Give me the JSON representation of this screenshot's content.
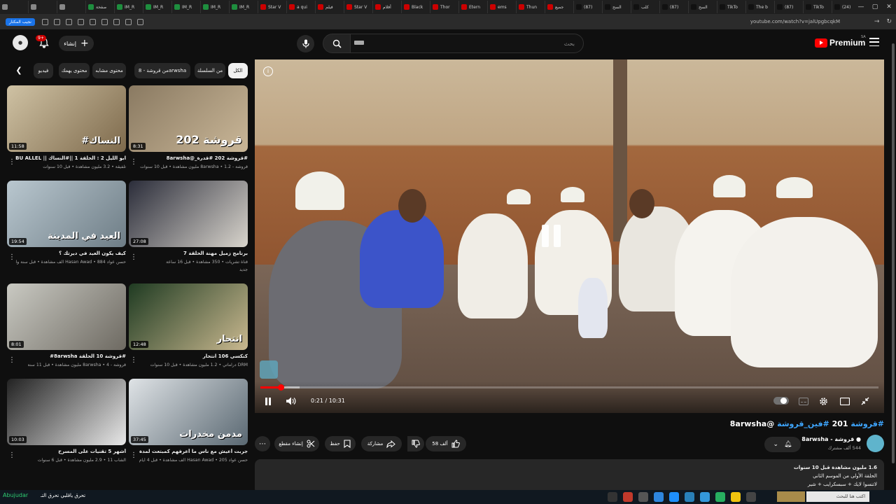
{
  "browser": {
    "tabs": [
      {
        "label": "",
        "color": "#888888"
      },
      {
        "label": "",
        "color": "#888888"
      },
      {
        "label": "",
        "color": "#888888"
      },
      {
        "label": "صفحة",
        "color": "#1e8e3e"
      },
      {
        "label": "IM_R",
        "color": "#1e8e3e"
      },
      {
        "label": "IM_R",
        "color": "#1e8e3e"
      },
      {
        "label": "IM_R",
        "color": "#1e8e3e"
      },
      {
        "label": "IM_R",
        "color": "#1e8e3e"
      },
      {
        "label": "IM_R",
        "color": "#1e8e3e"
      },
      {
        "label": "Star V",
        "color": "#cc0000"
      },
      {
        "label": "a qui",
        "color": "#cc0000"
      },
      {
        "label": "فيلم",
        "color": "#cc0000"
      },
      {
        "label": "Star V",
        "color": "#cc0000"
      },
      {
        "label": "أفلام",
        "color": "#cc0000"
      },
      {
        "label": "Black",
        "color": "#cc0000"
      },
      {
        "label": "Thor",
        "color": "#cc0000"
      },
      {
        "label": "Etern",
        "color": "#cc0000"
      },
      {
        "label": "ems",
        "color": "#cc0000"
      },
      {
        "label": "Thun",
        "color": "#cc0000"
      },
      {
        "label": "جميع",
        "color": "#cc0000"
      },
      {
        "label": "(87)",
        "color": "#111111"
      },
      {
        "label": "السح",
        "color": "#111111"
      },
      {
        "label": "كلب",
        "color": "#111111"
      },
      {
        "label": "(87)",
        "color": "#111111"
      },
      {
        "label": "السح",
        "color": "#111111"
      },
      {
        "label": "TikTo",
        "color": "#111111"
      },
      {
        "label": "The b",
        "color": "#111111"
      },
      {
        "label": "(87)",
        "color": "#111111"
      },
      {
        "label": "TikTo",
        "color": "#111111"
      },
      {
        "label": "(24)",
        "color": "#111111"
      },
      {
        "label": "(337)",
        "color": "#cc0000"
      },
      {
        "label": "",
        "color": "#cc0000"
      }
    ],
    "bookmark_button": "نجيب المكثار",
    "url": "youtube.com/watch?v=jalUpgbcqkM"
  },
  "header": {
    "notification_count": "9+",
    "create_label": "إنشاء",
    "search_placeholder": "بحث",
    "premium_label": "Premium",
    "country_code": "SA"
  },
  "chips": [
    {
      "label": "الكل",
      "active": true
    },
    {
      "label": "من السلسلة",
      "active": false
    },
    {
      "label": "من قروشة - 8arwsha",
      "active": false
    },
    {
      "label": "محتوى مشابه",
      "active": false
    },
    {
      "label": "محتوى يهمك",
      "active": false
    },
    {
      "label": "فيديو",
      "active": false
    }
  ],
  "recommendations": [
    {
      "title": "#قروشة 202 #قدرة_@8arwsha",
      "channel": "قروشة - 8arwsha",
      "meta": "1.2 مليون مشاهدة • قبل 10 سنوات",
      "meta2": "",
      "duration": "8:31",
      "overlay": "قروشة 202",
      "colors": [
        "#8a7a62",
        "#c9b697"
      ]
    },
    {
      "title": "ابو الليل 2 : الحلقة 1 ||#النساك || ABU ALLEL",
      "channel": "تلفيقة",
      "meta": "3.2 مليون مشاهدة • قبل 10 سنوات",
      "meta2": "",
      "duration": "11:58",
      "overlay": "#النساك",
      "colors": [
        "#cfc2a4",
        "#7e6a4c"
      ]
    },
    {
      "title": "برنامج زميل مهنة الحلقة 7",
      "channel": "قناة تشريات",
      "meta": "350 مشاهدة • قبل 16 ساعة",
      "meta2": "جديد",
      "duration": "27:08",
      "overlay": "",
      "colors": [
        "#2b2d3a",
        "#d8d4cc"
      ]
    },
    {
      "title": "كيف يكون العيد في ديرتك ؟",
      "channel": "حسن عواد Hasan Awad",
      "meta": "884 ألف مشاهدة • قبل سنة واحدة",
      "meta2": "",
      "duration": "19:54",
      "overlay": "العيد في المدينة",
      "colors": [
        "#b9c7cf",
        "#6e7d86"
      ]
    },
    {
      "title": "كنكسي 106 انتحار",
      "channel": "DRM دراماتي",
      "meta": "1.2 مليون مشاهدة • قبل 10 سنوات",
      "meta2": "",
      "duration": "12:48",
      "overlay": "انتحار",
      "colors": [
        "#1f3b22",
        "#c9b88f"
      ]
    },
    {
      "title": "#قروشة 10 الحلقة 8arwsha#",
      "channel": "قروشة - 8arwsha",
      "meta": "4 مليون مشاهدة • قبل 11 سنة",
      "meta2": "",
      "duration": "8:01",
      "overlay": "",
      "colors": [
        "#c9c9c2",
        "#6e6a62"
      ]
    },
    {
      "title": "جربت أعيش مع ناس ما أعرفهم كمبتعث لمدة 72 ساعة ! #حسن_يستكشف",
      "channel": "حسن عواد Hasan Awad",
      "meta": "205 ألف مشاهدة • قبل 4 أيام",
      "meta2": "",
      "duration": "37:45",
      "overlay": "مدمن مخدرات",
      "colors": [
        "#dfe3e6",
        "#5a6872"
      ]
    },
    {
      "title": "أشهر 5 تقنيات على المسرح",
      "channel": "الشاب 11",
      "meta": "2.9 مليون مشاهدة • قبل 6 سنوات",
      "meta2": "",
      "duration": "10:03",
      "overlay": "",
      "colors": [
        "#222222",
        "#e8e8e8"
      ]
    }
  ],
  "player": {
    "current_time": "0:21",
    "total_time": "10:31",
    "time_display": "0:21 / 10:31",
    "progress_fraction": 0.033,
    "buffered_fraction": 0.063
  },
  "video": {
    "title_tags": "#قروشة",
    "title_number": "201",
    "title_tag2": "#فين_قروشة",
    "title_handle": "@8arwsha",
    "channel": "قروشة - 8arwsha",
    "subscribers": "544 ألف مشترك",
    "likes": "58 ألف",
    "share_label": "مشاركة",
    "save_label": "حفظ",
    "clip_label": "إنشاء مقطع",
    "description": [
      "1.6 مليون مشاهدة قبل 10 سنوات",
      "الحلقة الأولى من الموسم الثاني",
      "لاتنسوا لايك + سبسكرايب + شير"
    ]
  },
  "taskbar": {
    "left_label": "Abujudar",
    "now_playing": "تحرق ياقلبي تحرق التـ",
    "search_placeholder": "اكتب هنا للبحث"
  }
}
